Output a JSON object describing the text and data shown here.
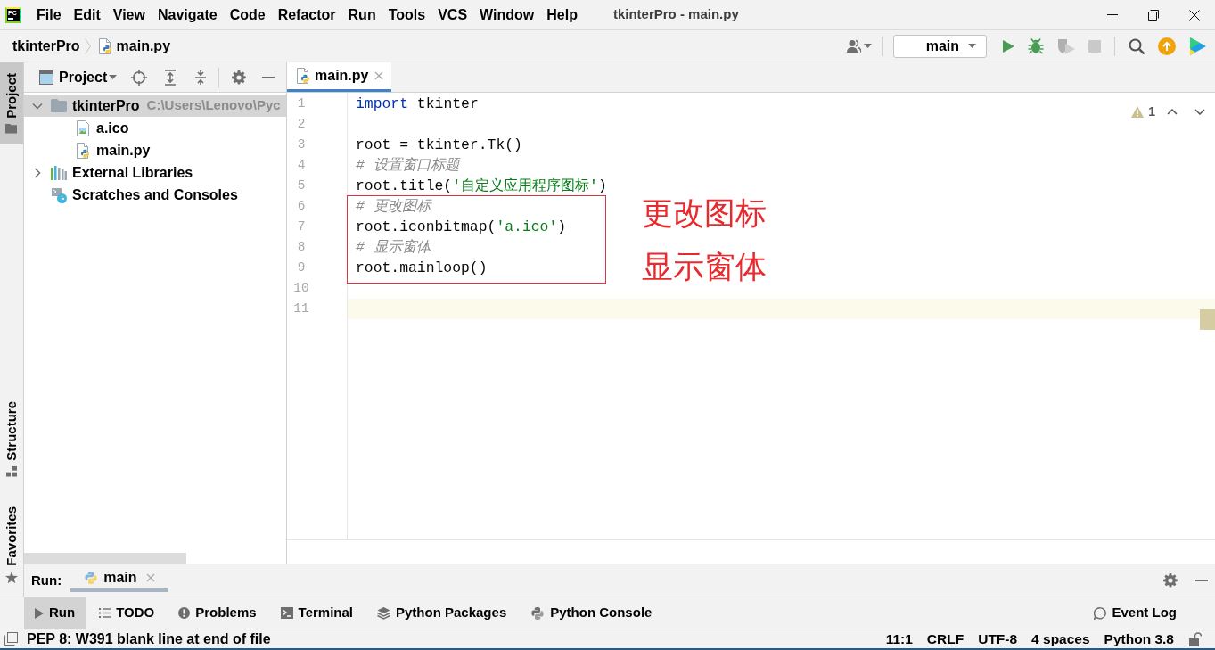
{
  "title_bar": {
    "logo_text": "PC",
    "menu": [
      "File",
      "Edit",
      "View",
      "Navigate",
      "Code",
      "Refactor",
      "Run",
      "Tools",
      "VCS",
      "Window",
      "Help"
    ],
    "title": "tkinterPro - main.py"
  },
  "navigation_bar": {
    "breadcrumbs": [
      {
        "label": "tkinterPro",
        "kind": "project"
      },
      {
        "label": "main.py",
        "kind": "python_file"
      }
    ],
    "run_configuration": "main",
    "actions": [
      {
        "kind": "run",
        "disabled": false
      },
      {
        "kind": "debug",
        "disabled": false
      },
      {
        "kind": "coverage",
        "disabled": true
      },
      {
        "kind": "stop",
        "disabled": true
      },
      {
        "kind": "search",
        "disabled": false
      },
      {
        "kind": "update",
        "disabled": false
      },
      {
        "kind": "toolbox",
        "disabled": false
      }
    ]
  },
  "tool_stripe": {
    "top": [
      {
        "label": "Project",
        "kind": "project",
        "selected": true
      }
    ],
    "bottom": [
      {
        "label": "Structure",
        "kind": "structure",
        "selected": false
      },
      {
        "label": "Favorites",
        "kind": "favorites",
        "selected": false
      }
    ]
  },
  "project_panel": {
    "title": "Project",
    "tree": [
      {
        "label": "tkinterPro",
        "path": "C:\\Users\\Lenovo\\Pyc",
        "kind": "folder",
        "expanded": true,
        "selected": true,
        "children": [
          {
            "label": "a.ico",
            "kind": "image_file",
            "selected": false
          },
          {
            "label": "main.py",
            "kind": "python_file",
            "selected": false
          }
        ]
      },
      {
        "label": "External Libraries",
        "kind": "libraries",
        "expanded": false,
        "selected": false
      },
      {
        "label": "Scratches and Consoles",
        "kind": "scratches",
        "selected": false
      }
    ]
  },
  "editor": {
    "tabs": [
      {
        "label": "main.py",
        "kind": "python_file",
        "selected": true
      }
    ],
    "warning_count": "1",
    "lines": [
      {
        "number": "1",
        "current": false,
        "boxed": false,
        "tokens": [
          {
            "kind": "keyword",
            "text": "import"
          },
          {
            "kind": "plain",
            "text": " tkinter"
          }
        ]
      },
      {
        "number": "2",
        "current": false,
        "boxed": false
      },
      {
        "number": "3",
        "current": false,
        "boxed": false,
        "tokens": [
          {
            "kind": "plain",
            "text": "root = tkinter.Tk()"
          }
        ]
      },
      {
        "number": "4",
        "current": false,
        "boxed": false,
        "tokens": [
          {
            "kind": "comment",
            "text": "# 设置窗口标题"
          }
        ]
      },
      {
        "number": "5",
        "current": false,
        "boxed": false,
        "tokens": [
          {
            "kind": "plain",
            "text": "root.title("
          },
          {
            "kind": "string",
            "text": "'自定义应用程序图标'"
          },
          {
            "kind": "plain",
            "text": ")"
          }
        ]
      },
      {
        "number": "6",
        "current": false,
        "boxed": true,
        "tokens": [
          {
            "kind": "comment",
            "text": "# 更改图标"
          }
        ]
      },
      {
        "number": "7",
        "current": false,
        "boxed": true,
        "tokens": [
          {
            "kind": "plain",
            "text": "root.iconbitmap("
          },
          {
            "kind": "string",
            "text": "'a.ico'"
          },
          {
            "kind": "plain",
            "text": ")"
          }
        ]
      },
      {
        "number": "8",
        "current": false,
        "boxed": true,
        "tokens": [
          {
            "kind": "comment",
            "text": "# 显示窗体"
          }
        ]
      },
      {
        "number": "9",
        "current": false,
        "boxed": true,
        "tokens": [
          {
            "kind": "plain",
            "text": "root.mainloop()"
          }
        ]
      },
      {
        "number": "10",
        "current": false,
        "boxed": false
      },
      {
        "number": "11",
        "current": true,
        "boxed": false
      }
    ],
    "notes": [
      "更改图标",
      "显示窗体"
    ]
  },
  "run_panel": {
    "title": "Run:",
    "tabs": [
      {
        "label": "main",
        "selected": true
      }
    ]
  },
  "tool_tabs": {
    "left": [
      {
        "label": "Run",
        "kind": "run",
        "selected": true
      },
      {
        "label": "TODO",
        "kind": "todo",
        "selected": false
      },
      {
        "label": "Problems",
        "kind": "problems",
        "selected": false
      },
      {
        "label": "Terminal",
        "kind": "terminal",
        "selected": false
      },
      {
        "label": "Python Packages",
        "kind": "packages",
        "selected": false
      },
      {
        "label": "Python Console",
        "kind": "console",
        "selected": false
      }
    ],
    "right": [
      {
        "label": "Event Log",
        "kind": "event_log",
        "selected": false
      }
    ]
  },
  "status_bar": {
    "message": "PEP 8: W391 blank line at end of file",
    "items": [
      "11:1",
      "CRLF",
      "UTF-8",
      "4 spaces",
      "Python 3.8"
    ],
    "read_only": false
  }
}
